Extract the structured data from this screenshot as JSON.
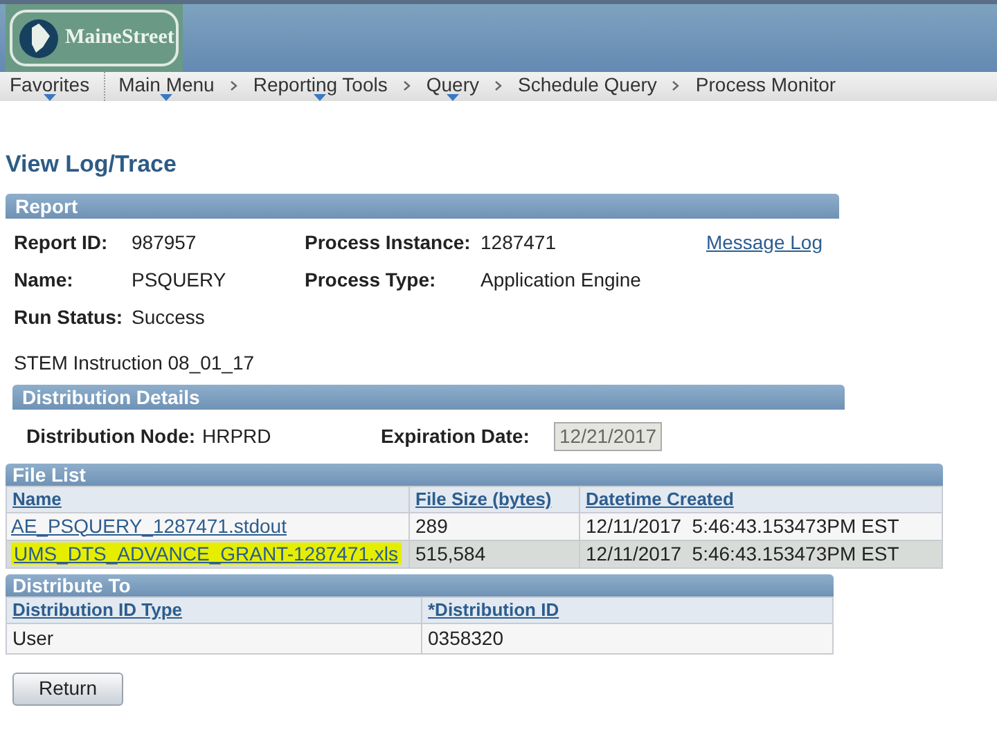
{
  "header": {
    "logo_text": "MaineStreet"
  },
  "nav": [
    {
      "label": "Favorites",
      "dropdown": true
    },
    {
      "label": "Main Menu",
      "dropdown": true
    },
    {
      "label": "Reporting Tools",
      "dropdown": true
    },
    {
      "label": "Query",
      "dropdown": true
    },
    {
      "label": "Schedule Query",
      "dropdown": false
    },
    {
      "label": "Process Monitor",
      "dropdown": false
    }
  ],
  "page_title": "View Log/Trace",
  "report": {
    "title": "Report",
    "fields": [
      {
        "label": "Report ID:",
        "value": "987957"
      },
      {
        "label": "Process Instance:",
        "value": "1287471"
      },
      {
        "label": "Name:",
        "value": "PSQUERY"
      },
      {
        "label": "Process Type:",
        "value": "Application Engine"
      },
      {
        "label": "Run Status:",
        "value": "Success"
      }
    ],
    "message_log_link": "Message Log",
    "description": "STEM Instruction 08_01_17"
  },
  "distribution_details": {
    "title": "Distribution Details",
    "node_label": "Distribution Node:",
    "node_value": "HRPRD",
    "expiration_label": "Expiration Date:",
    "expiration_value": "12/21/2017"
  },
  "file_list": {
    "title": "File List",
    "columns": [
      "Name",
      "File Size (bytes)",
      "Datetime Created"
    ],
    "rows": [
      {
        "name": "AE_PSQUERY_1287471.stdout",
        "size": "289",
        "created": "12/11/2017  5:46:43.153473PM EST",
        "highlighted": false
      },
      {
        "name": "UMS_DTS_ADVANCE_GRANT-1287471.xls",
        "size": "515,584",
        "created": "12/11/2017  5:46:43.153473PM EST",
        "highlighted": true
      }
    ]
  },
  "distribute_to": {
    "title": "Distribute To",
    "columns": [
      "Distribution ID Type",
      "*Distribution ID"
    ],
    "rows": [
      {
        "type": "User",
        "id": "0358320"
      }
    ]
  },
  "buttons": [
    "Return"
  ]
}
